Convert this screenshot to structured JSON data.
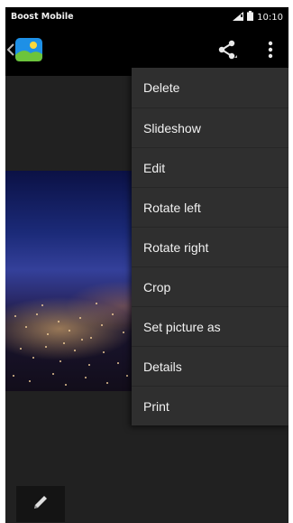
{
  "status_bar": {
    "carrier": "Boost Mobile",
    "time": "10:10",
    "icons": [
      "signal-icon",
      "battery-icon"
    ]
  },
  "action_bar": {
    "back_icon": "back-chevron-icon",
    "app_icon": "gallery-app-icon",
    "share_icon": "share-icon",
    "overflow_icon": "more-vert-icon"
  },
  "menu": {
    "items": [
      {
        "label": "Delete"
      },
      {
        "label": "Slideshow"
      },
      {
        "label": "Edit"
      },
      {
        "label": "Rotate left"
      },
      {
        "label": "Rotate right"
      },
      {
        "label": "Crop"
      },
      {
        "label": "Set picture as"
      },
      {
        "label": "Details"
      },
      {
        "label": "Print"
      }
    ]
  },
  "bottom": {
    "edit_icon": "pencil-icon"
  },
  "colors": {
    "status_bar": "#000000",
    "action_bar": "#000000",
    "background": "#212121",
    "menu_background": "#2f2f2f",
    "menu_text": "#f2f2f2"
  }
}
